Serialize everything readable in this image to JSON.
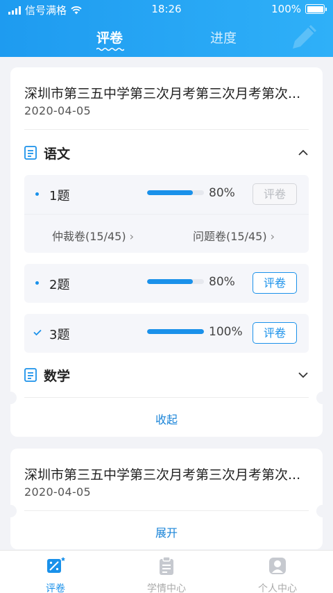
{
  "status_bar": {
    "carrier": "信号满格",
    "time": "18:26",
    "battery": "100%"
  },
  "header": {
    "tabs": [
      {
        "label": "评卷",
        "active": true
      },
      {
        "label": "进度",
        "active": false
      }
    ]
  },
  "exams": [
    {
      "title": "深圳市第三五中学第三次月考第三次月考第次...",
      "date": "2020-04-05",
      "expanded": true,
      "subjects": [
        {
          "name": "语文",
          "expanded": true,
          "questions": [
            {
              "label": "1题",
              "progress": 0.8,
              "percent": "80%",
              "button": "评卷",
              "button_enabled": false,
              "done": false,
              "links": [
                "仲裁卷(15/45)",
                "问题卷(15/45)"
              ]
            },
            {
              "label": "2题",
              "progress": 0.8,
              "percent": "80%",
              "button": "评卷",
              "button_enabled": true,
              "done": false
            },
            {
              "label": "3题",
              "progress": 1.0,
              "percent": "100%",
              "button": "评卷",
              "button_enabled": true,
              "done": true
            }
          ]
        },
        {
          "name": "数学",
          "expanded": false
        }
      ],
      "toggle_label": "收起"
    },
    {
      "title": "深圳市第三五中学第三次月考第三次月考第次...",
      "date": "2020-04-05",
      "expanded": false,
      "toggle_label": "展开"
    }
  ],
  "bottom_nav": [
    {
      "label": "评卷",
      "icon": "grading-icon",
      "active": true
    },
    {
      "label": "学情中心",
      "icon": "clipboard-icon",
      "active": false
    },
    {
      "label": "个人中心",
      "icon": "person-icon",
      "active": false
    }
  ],
  "colors": {
    "primary": "#1a91ea",
    "header_gradient_start": "#1e9bf0",
    "header_gradient_end": "#2fb0f8",
    "background": "#f2f3f7"
  }
}
